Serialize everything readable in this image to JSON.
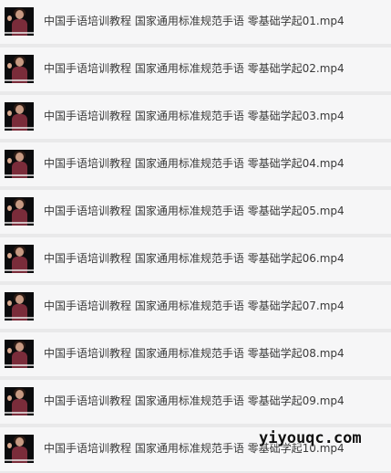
{
  "files": [
    {
      "name": "中国手语培训教程 国家通用标准规范手语 零基础学起01.mp4",
      "icon": "video-thumbnail-icon"
    },
    {
      "name": "中国手语培训教程 国家通用标准规范手语 零基础学起02.mp4",
      "icon": "video-thumbnail-icon"
    },
    {
      "name": "中国手语培训教程 国家通用标准规范手语 零基础学起03.mp4",
      "icon": "video-thumbnail-icon"
    },
    {
      "name": "中国手语培训教程 国家通用标准规范手语 零基础学起04.mp4",
      "icon": "video-thumbnail-icon"
    },
    {
      "name": "中国手语培训教程 国家通用标准规范手语 零基础学起05.mp4",
      "icon": "video-thumbnail-icon"
    },
    {
      "name": "中国手语培训教程 国家通用标准规范手语 零基础学起06.mp4",
      "icon": "video-thumbnail-icon"
    },
    {
      "name": "中国手语培训教程 国家通用标准规范手语 零基础学起07.mp4",
      "icon": "video-thumbnail-icon"
    },
    {
      "name": "中国手语培训教程 国家通用标准规范手语 零基础学起08.mp4",
      "icon": "video-thumbnail-icon"
    },
    {
      "name": "中国手语培训教程 国家通用标准规范手语 零基础学起09.mp4",
      "icon": "video-thumbnail-icon"
    },
    {
      "name": "中国手语培训教程 国家通用标准规范手语 零基础学起10.mp4",
      "icon": "video-thumbnail-icon"
    }
  ],
  "watermark": "yiyouqc.com",
  "colors": {
    "background": "#e9e9ea",
    "row": "#f6f6f7",
    "text": "#3a3a3a"
  }
}
